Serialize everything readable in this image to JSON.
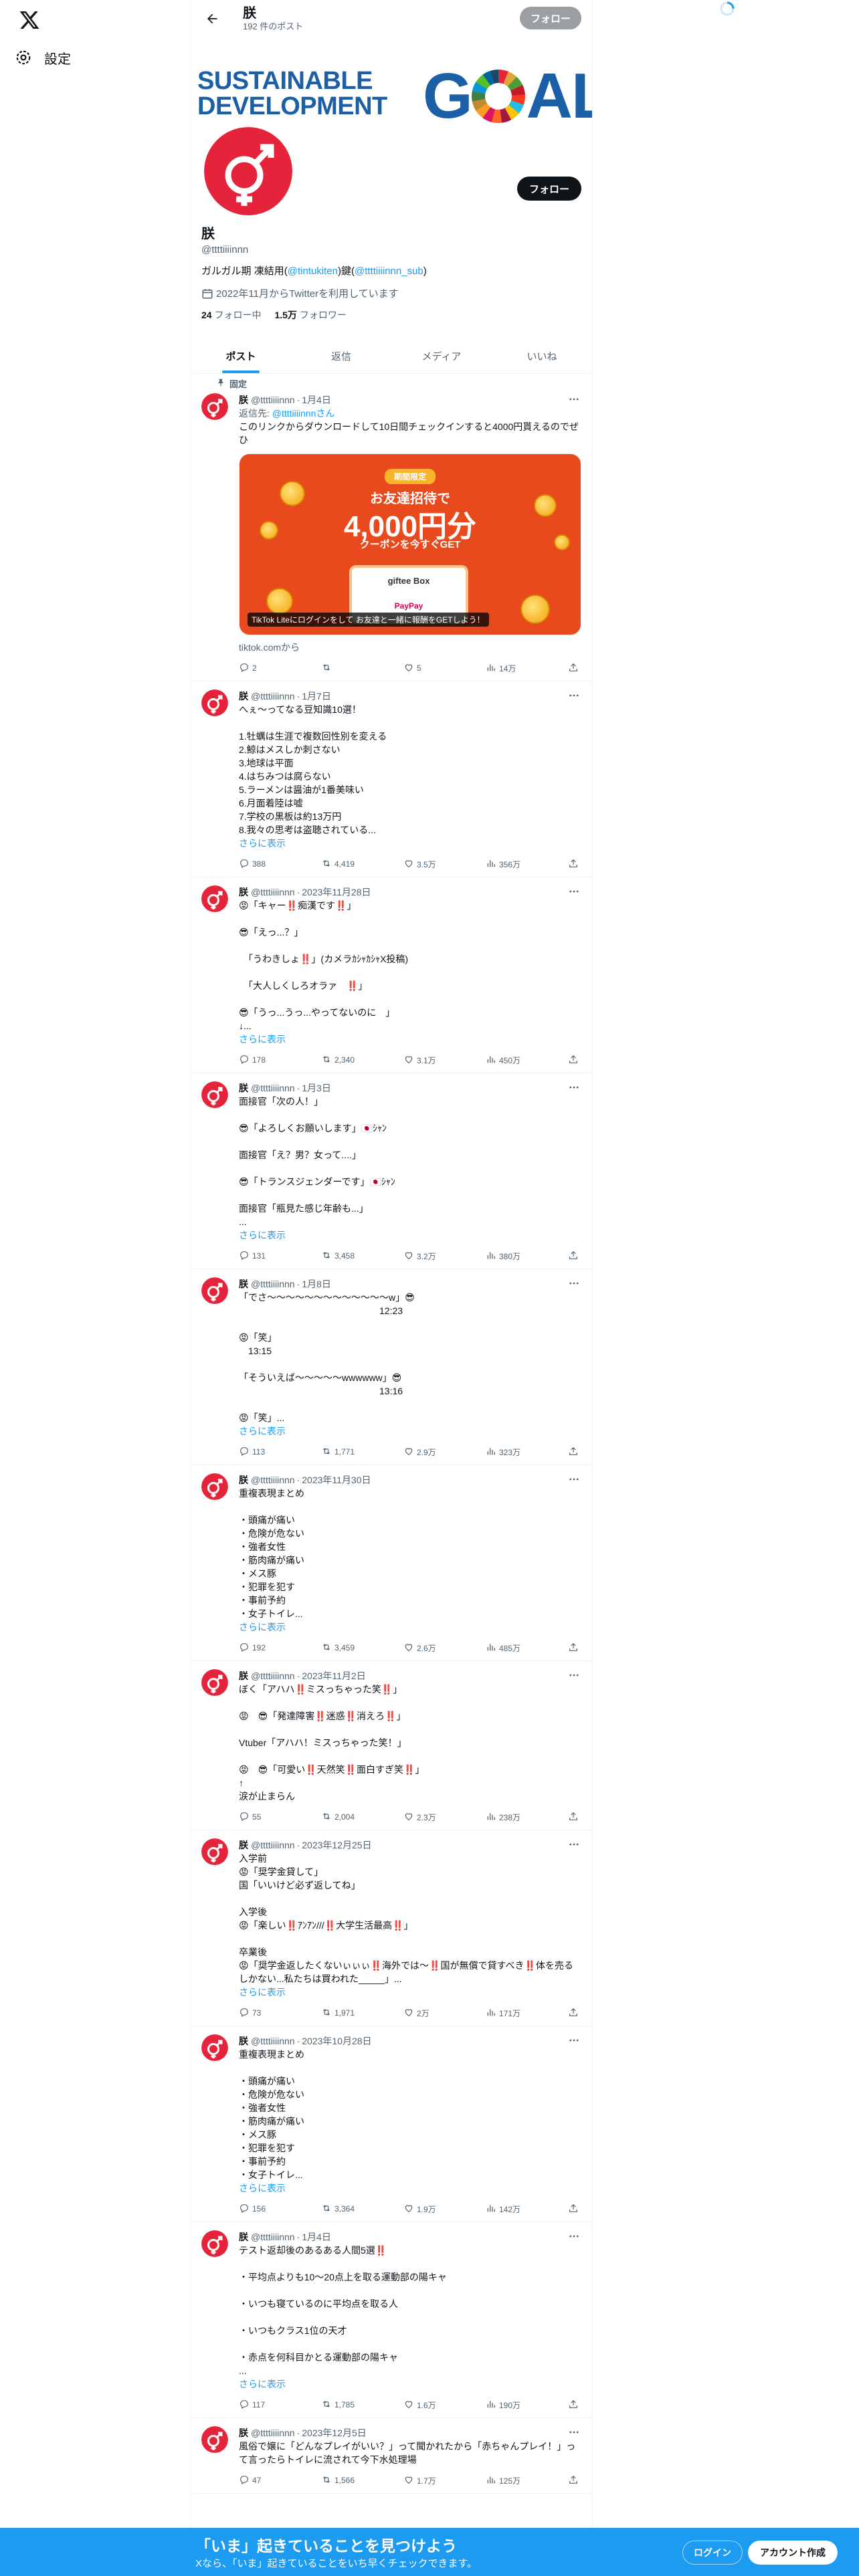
{
  "nav": {
    "settings_label": "設定"
  },
  "header": {
    "name": "朕",
    "post_count": "192 件のポスト",
    "follow_label": "フォロー"
  },
  "banner": {
    "line1": "SUSTAINABLE",
    "line2": "DEVELOPMENT",
    "goals_g": "G",
    "goals_rest": "ALS"
  },
  "profile": {
    "name": "朕",
    "handle": "@ttttiiiinnn",
    "follow_label": "フォロー",
    "bio_prefix": "ガルガル期 凍結用(",
    "bio_link1": "@tintukiten",
    "bio_mid": ")鍵(",
    "bio_link2": "@ttttiiiinnn_sub",
    "bio_suffix": ")",
    "joined": "2022年11月からTwitterを利用しています",
    "following_count": "24",
    "following_label": "フォロー中",
    "followers_count": "1.5万",
    "followers_label": "フォロワー"
  },
  "tabs": [
    {
      "label": "ポスト"
    },
    {
      "label": "返信"
    },
    {
      "label": "メディア"
    },
    {
      "label": "いいね"
    }
  ],
  "pinned_label": "固定",
  "show_more": "さらに表示",
  "colors": {
    "accent": "#1d9bf0",
    "avatar_red": "#e5243b"
  },
  "tweets": [
    {
      "name": "朕",
      "handle": "@ttttiiiinnn",
      "date": "1月4日",
      "reply_prefix": "返信先: ",
      "reply_to": "@ttttiiiinnnさん",
      "text": "このリンクからダウンロードして10日間チェックインすると4000円貰えるのでぜひ",
      "card": {
        "badge": "期間限定",
        "line1": "お友達招待で",
        "amount": "4,000円分",
        "line3": "クーポンを今すぐGET",
        "box1": "giftee Box",
        "box2": "PayPay",
        "caption": "TikTok Liteにログインをして お友達と一緒に報酬をGETしよう！"
      },
      "source": "tiktok.comから",
      "replies": "2",
      "retweets": "",
      "likes": "5",
      "views": "14万"
    },
    {
      "name": "朕",
      "handle": "@ttttiiiinnn",
      "date": "1月7日",
      "text": "へぇ〜ってなる豆知識10選！\n\n1.牡蠣は生涯で複数回性別を変える\n2.鯨はメスしか刺さない\n3.地球は平面\n4.はちみつは腐らない\n5.ラーメンは醤油が1番美味い\n6.月面着陸は嘘\n7.学校の黒板は約13万円\n8.我々の思考は盗聴されている...",
      "more": true,
      "replies": "388",
      "retweets": "4,419",
      "likes": "3.5万",
      "views": "356万"
    },
    {
      "name": "朕",
      "handle": "@ttttiiiinnn",
      "date": "2023年11月28日",
      "text": "😡「キャー‼️痴漢です‼️」\n\n😎「えっ...？」\n\n　「うわきしょ‼️」(カメラｶｼｬｶｼｬX投稿)\n\n　「大人しくしろオラァ　‼️」\n\n😎「うっ...うっ...やってないのに　」\n↓...",
      "more": true,
      "replies": "178",
      "retweets": "2,340",
      "likes": "3.1万",
      "views": "450万"
    },
    {
      "name": "朕",
      "handle": "@ttttiiiinnn",
      "date": "1月3日",
      "text": "面接官「次の人！」\n\n😎「よろしくお願いします」🇯🇵ｼｬﾝ\n\n面接官「え？男？女って....」\n\n😎「トランスジェンダーです」🇯🇵ｼｬﾝ\n\n面接官「瓶見た感じ年齢も...」\n...",
      "more": true,
      "replies": "131",
      "retweets": "3,458",
      "likes": "3.2万",
      "views": "380万"
    },
    {
      "name": "朕",
      "handle": "@ttttiiiinnn",
      "date": "1月8日",
      "text": "「でさ〜〜〜〜〜〜〜〜〜〜〜〜〜w」😎\n　　　　　　　　　　　　　　　12:23\n\n😡「笑」\n　13:15\n\n「そういえば〜〜〜〜〜wwwwww」😎\n　　　　　　　　　　　　　　　13:16\n\n😡「笑」...",
      "more": true,
      "replies": "113",
      "retweets": "1,771",
      "likes": "2.9万",
      "views": "323万"
    },
    {
      "name": "朕",
      "handle": "@ttttiiiinnn",
      "date": "2023年11月30日",
      "text": "重複表現まとめ\n\n・頭痛が痛い\n・危険が危ない\n・強者女性\n・筋肉痛が痛い\n・メス豚\n・犯罪を犯す\n・事前予約\n・女子トイレ...",
      "more": true,
      "replies": "192",
      "retweets": "3,459",
      "likes": "2.6万",
      "views": "485万"
    },
    {
      "name": "朕",
      "handle": "@ttttiiiinnn",
      "date": "2023年11月2日",
      "text": "ぼく「アハハ‼️ミスっちゃった笑‼️」\n\n😡　😎「発達障害‼️迷惑‼️消えろ‼️」\n\nVtuber「アハハ！ミスっちゃった笑！」\n\n😡　😎「可愛い‼️天然笑‼️面白すぎ笑‼️」\n↑\n涙が止まらん",
      "more": false,
      "replies": "55",
      "retweets": "2,004",
      "likes": "2.3万",
      "views": "238万"
    },
    {
      "name": "朕",
      "handle": "@ttttiiiinnn",
      "date": "2023年12月25日",
      "text": "入学前\n😡「奨学金貸して」\n国「いいけど必ず返してね」\n\n入学後\n😡「楽しい‼️ｱﾝｱﾝ///‼️大学生活最高‼️」\n\n卒業後\n😡「奨学金返したくないぃぃぃ‼️海外では〜‼️国が無償で貸すべき‼️体を売るしかない...私たちは買われた_____」...",
      "more": true,
      "replies": "73",
      "retweets": "1,971",
      "likes": "2万",
      "views": "171万"
    },
    {
      "name": "朕",
      "handle": "@ttttiiiinnn",
      "date": "2023年10月28日",
      "text": "重複表現まとめ\n\n・頭痛が痛い\n・危険が危ない\n・強者女性\n・筋肉痛が痛い\n・メス豚\n・犯罪を犯す\n・事前予約\n・女子トイレ...",
      "more": true,
      "replies": "156",
      "retweets": "3,364",
      "likes": "1.9万",
      "views": "142万"
    },
    {
      "name": "朕",
      "handle": "@ttttiiiinnn",
      "date": "1月4日",
      "text": "テスト返却後のあるある人間5選‼️\n\n・平均点よりも10〜20点上を取る運動部の陽キャ\n\n・いつも寝ているのに平均点を取る人\n\n・いつもクラス1位の天才\n\n・赤点を何科目かとる運動部の陽キャ\n...",
      "more": true,
      "replies": "117",
      "retweets": "1,785",
      "likes": "1.6万",
      "views": "190万"
    },
    {
      "name": "朕",
      "handle": "@ttttiiiinnn",
      "date": "2023年12月5日",
      "text": "風俗で嬢に「どんなプレイがいい？」って聞かれたから「赤ちゃんプレイ！」って言ったらトイレに流されて今下水処理場",
      "more": false,
      "replies": "47",
      "retweets": "1,566",
      "likes": "1.7万",
      "views": "125万"
    }
  ],
  "bottombar": {
    "title": "「いま」起きていることを見つけよう",
    "subtitle": "Xなら、「いま」起きていることをいち早くチェックできます。",
    "login_label": "ログイン",
    "signup_label": "アカウント作成"
  }
}
